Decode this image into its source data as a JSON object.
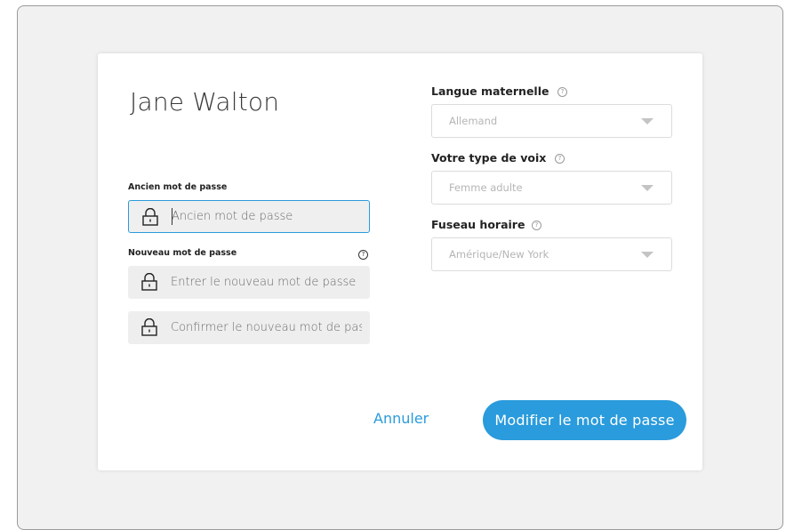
{
  "user": {
    "name": "Jane Walton"
  },
  "password": {
    "old_label": "Ancien mot de passe",
    "old_placeholder": "Ancien mot de passe",
    "new_label": "Nouveau mot de passe",
    "new_placeholder": "Entrer le nouveau mot de passe",
    "confirm_placeholder": "Confirmer le nouveau mot de passe"
  },
  "settings": {
    "language_label": "Langue maternelle",
    "language_value": "Allemand",
    "voice_label": "Votre type de voix",
    "voice_value": "Femme adulte",
    "timezone_label": "Fuseau horaire",
    "timezone_value": "Amérique/New York"
  },
  "actions": {
    "cancel_label": "Annuler",
    "submit_label": "Modifier le mot de passe"
  },
  "icons": {
    "lock": "lock-icon",
    "help": "help-icon",
    "dropdown": "chevron-down-icon"
  },
  "colors": {
    "accent": "#2a9bdc",
    "field_bg": "#eeeeee"
  }
}
